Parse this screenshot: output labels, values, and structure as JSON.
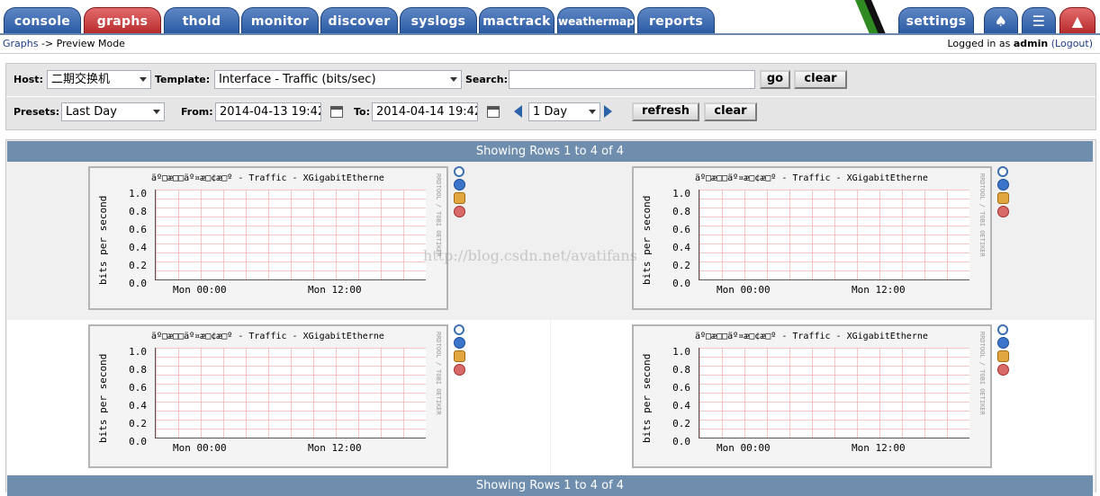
{
  "nav": {
    "tabs": [
      "console",
      "graphs",
      "thold",
      "monitor",
      "discover",
      "syslogs",
      "mactrack",
      "weathermap",
      "reports"
    ],
    "active": "graphs",
    "settings": "settings",
    "icon_tabs": [
      "tree-icon",
      "list-icon",
      "preview-icon"
    ]
  },
  "breadcrumb": {
    "link": "Graphs",
    "rest": "-> Preview Mode"
  },
  "login": {
    "prefix": "Logged in as",
    "user": "admin",
    "logout": "(Logout)"
  },
  "filter": {
    "host_label": "Host:",
    "host_value": "二期交换机",
    "template_label": "Template:",
    "template_value": "Interface - Traffic (bits/sec)",
    "search_label": "Search:",
    "search_value": "",
    "go": "go",
    "clear": "clear",
    "presets_label": "Presets:",
    "presets_value": "Last Day",
    "from_label": "From:",
    "from_value": "2014-04-13 19:42",
    "to_label": "To:",
    "to_value": "2014-04-14 19:42",
    "span_value": "1 Day",
    "refresh": "refresh",
    "clear2": "clear"
  },
  "results": {
    "header": "Showing Rows 1 to 4 of 4",
    "footer": "Showing Rows 1 to 4 of 4"
  },
  "graphs": [
    {
      "title": "äº□æ□□äº¤æ□¢æ□º - Traffic - XGigabitEtherne"
    },
    {
      "title": "äº□æ□□äº¤æ□¢æ□º - Traffic - XGigabitEtherne"
    },
    {
      "title": "äº□æ□□äº¤æ□¢æ□º - Traffic - XGigabitEtherne"
    },
    {
      "title": "äº□æ□□äº¤æ□¢æ□º - Traffic - XGigabitEtherne"
    }
  ],
  "graph_common": {
    "ylabel": "bits per second",
    "yticks": [
      "1.0",
      "0.8",
      "0.6",
      "0.4",
      "0.2",
      "0.0"
    ],
    "xticks": [
      "Mon 00:00",
      "Mon 12:00"
    ],
    "side_text": "RRDTOOL / TOBI OETIKER"
  },
  "watermark": "http://blog.csdn.net/avatifans"
}
